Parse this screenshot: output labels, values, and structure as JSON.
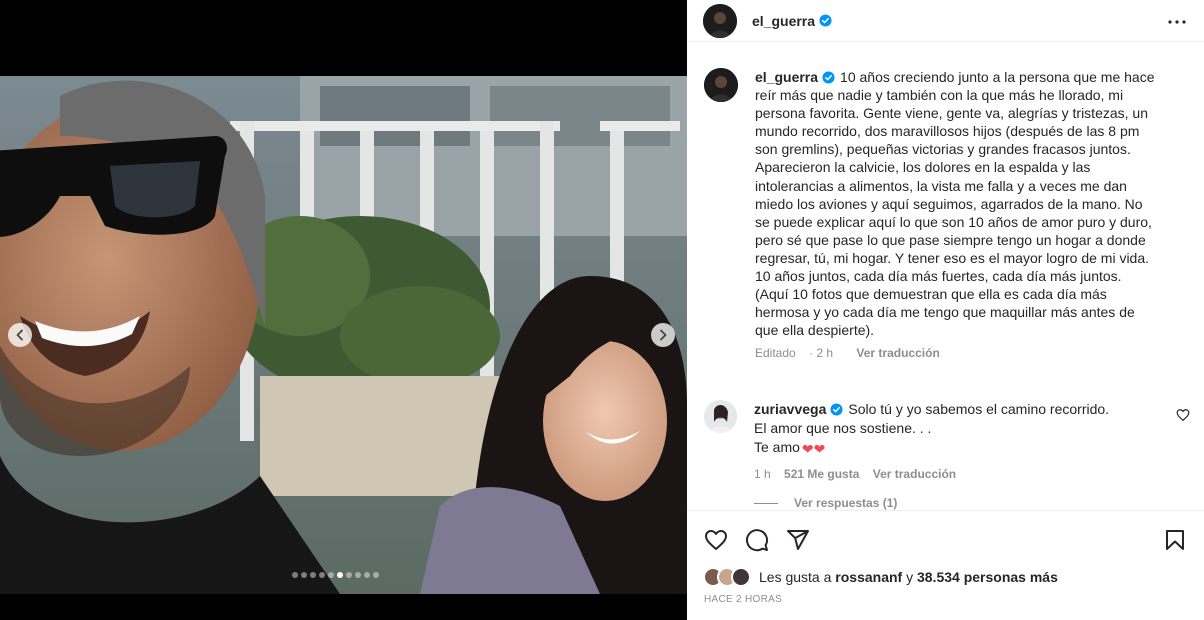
{
  "post": {
    "author": "el_guerra",
    "caption": "10 años creciendo junto a la persona que me hace reír más que nadie y también con la que más he llorado, mi persona favorita. Gente viene, gente va, alegrías y tristezas, un mundo recorrido, dos maravillosos hijos (después de las 8 pm son gremlins), pequeñas victorias y grandes fracasos juntos. Aparecieron la calvicie, los dolores en la espalda y las intolerancias a alimentos, la vista me falla y a veces me dan miedo los aviones y aquí seguimos, agarrados de la mano. No se puede explicar aquí lo que son 10 años de amor puro y duro, pero sé que pase lo que pase siempre tengo un hogar a donde regresar, tú, mi hogar. Y tener eso es el mayor logro de mi vida. 10 años juntos, cada día más fuertes, cada día más juntos. (Aquí 10 fotos que demuestran que ella es cada día más hermosa y yo cada día me tengo que maquillar más antes de que ella despierte).",
    "edited_label": "Editado",
    "age": "2 h",
    "translate_label": "Ver traducción"
  },
  "comment": {
    "user": "zuriavvega",
    "text": "Solo tú y yo sabemos el camino recorrido.\nEl amor que nos sostiene. . .\nTe amo",
    "emoji": "❤❤",
    "age": "1 h",
    "likes": "521 Me gusta",
    "translate_label": "Ver traducción",
    "replies_label": "Ver respuestas (1)"
  },
  "likes": {
    "prefix": "Les gusta a",
    "user": "rossananf",
    "connector": "y",
    "others": "38.534 personas más"
  },
  "timestamp": "HACE 2 HORAS",
  "carousel": {
    "count": 10,
    "active_index": 5
  },
  "colors": {
    "verified": "#0095f6",
    "heart": "#ed4956",
    "meta": "#8e8e8e"
  },
  "icons": [
    "more-icon",
    "heart-icon",
    "comment-icon",
    "share-icon",
    "bookmark-icon",
    "chevron-left-icon",
    "chevron-right-icon",
    "verified-badge-icon"
  ]
}
